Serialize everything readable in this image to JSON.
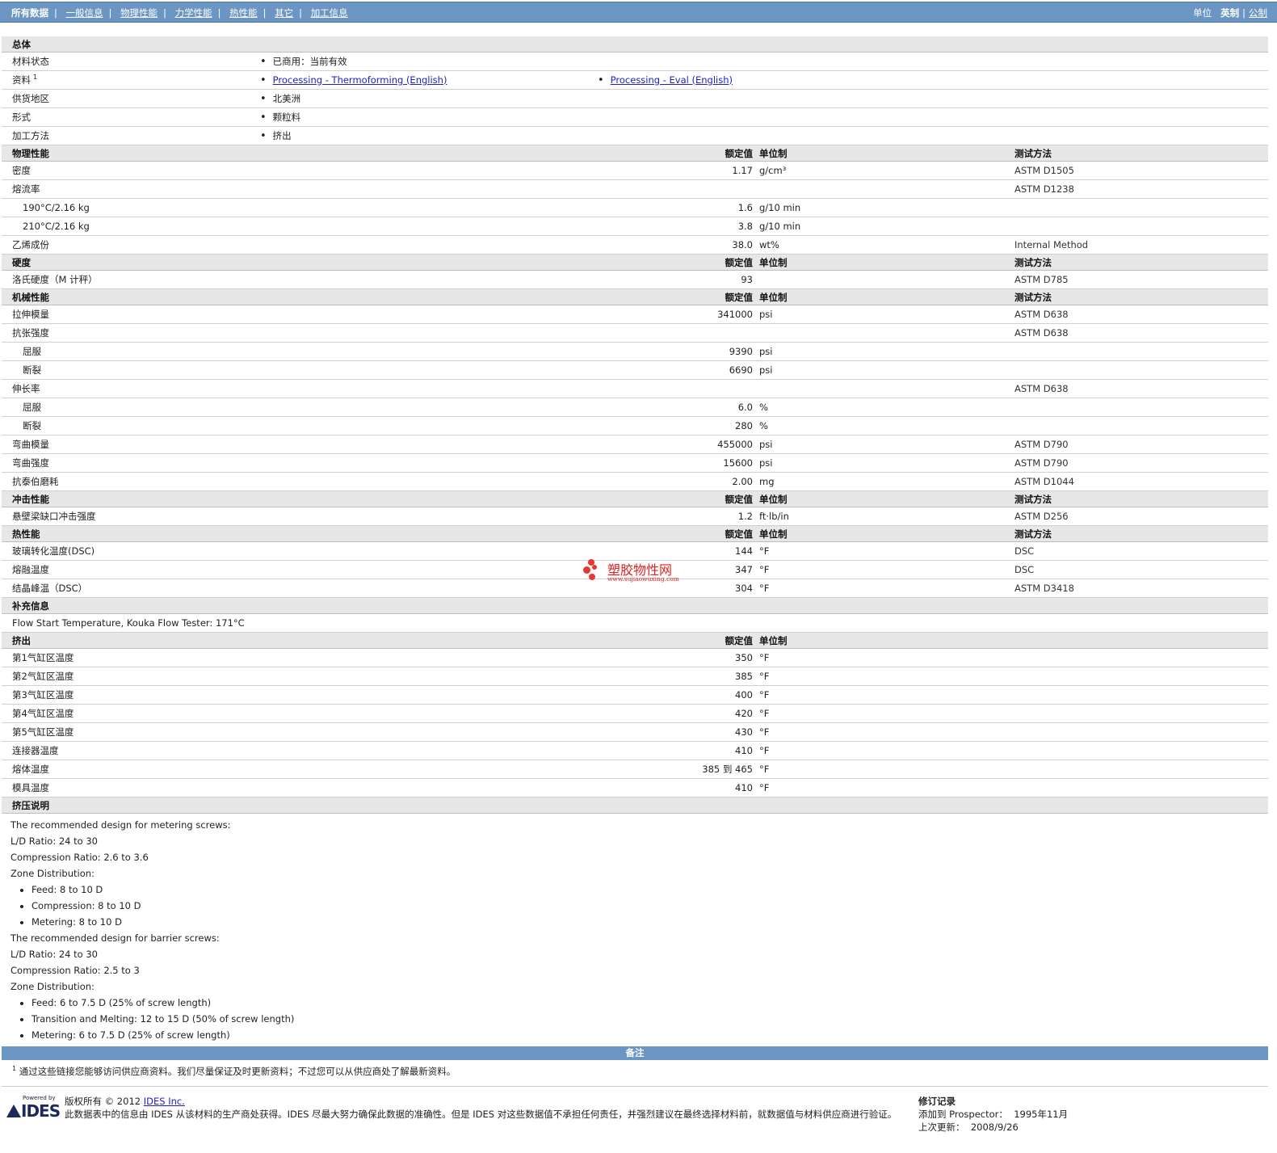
{
  "nav": {
    "items": [
      "所有数据",
      "一般信息",
      "物理性能",
      "力学性能",
      "热性能",
      "其它",
      "加工信息"
    ],
    "units_label": "单位",
    "units_current": "英制",
    "units_other": "公制"
  },
  "general": {
    "title": "总体",
    "rows": [
      {
        "label": "材料状态",
        "value": "已商用：当前有效"
      },
      {
        "label": "资料",
        "sup": "1",
        "link1": "Processing - Thermoforming (English)",
        "link2": "Processing - Eval (English)"
      },
      {
        "label": "供货地区",
        "value": "北美洲"
      },
      {
        "label": "形式",
        "value": "颗粒料"
      },
      {
        "label": "加工方法",
        "value": "挤出"
      }
    ]
  },
  "headers": {
    "nominal": "额定值",
    "unit": "单位制",
    "test": "测试方法"
  },
  "physical": {
    "title": "物理性能",
    "rows": [
      {
        "label": "密度",
        "value": "1.17",
        "unit": "g/cm³",
        "test": "ASTM D1505"
      },
      {
        "label": "熔流率",
        "value": "",
        "unit": "",
        "test": "ASTM D1238"
      },
      {
        "label": "190°C/2.16 kg",
        "value": "1.6",
        "unit": "g/10 min",
        "test": "",
        "sub": true
      },
      {
        "label": "210°C/2.16 kg",
        "value": "3.8",
        "unit": "g/10 min",
        "test": "",
        "sub": true
      },
      {
        "label": "乙烯成份",
        "value": "38.0",
        "unit": "wt%",
        "test": "Internal Method"
      }
    ]
  },
  "hardness": {
    "title": "硬度",
    "rows": [
      {
        "label": "洛氏硬度（M 计秤）",
        "value": "93",
        "unit": "",
        "test": "ASTM D785"
      }
    ]
  },
  "mechanical": {
    "title": "机械性能",
    "rows": [
      {
        "label": "拉伸模量",
        "value": "341000",
        "unit": "psi",
        "test": "ASTM D638"
      },
      {
        "label": "抗张强度",
        "value": "",
        "unit": "",
        "test": "ASTM D638"
      },
      {
        "label": "屈服",
        "value": "9390",
        "unit": "psi",
        "test": "",
        "sub": true
      },
      {
        "label": "断裂",
        "value": "6690",
        "unit": "psi",
        "test": "",
        "sub": true
      },
      {
        "label": "伸长率",
        "value": "",
        "unit": "",
        "test": "ASTM D638"
      },
      {
        "label": "屈服",
        "value": "6.0",
        "unit": "%",
        "test": "",
        "sub": true
      },
      {
        "label": "断裂",
        "value": "280",
        "unit": "%",
        "test": "",
        "sub": true
      },
      {
        "label": "弯曲模量",
        "value": "455000",
        "unit": "psi",
        "test": "ASTM D790"
      },
      {
        "label": "弯曲强度",
        "value": "15600",
        "unit": "psi",
        "test": "ASTM D790"
      },
      {
        "label": "抗泰伯磨耗",
        "value": "2.00",
        "unit": "mg",
        "test": "ASTM D1044"
      }
    ]
  },
  "impact": {
    "title": "冲击性能",
    "rows": [
      {
        "label": "悬壁梁缺口冲击强度",
        "value": "1.2",
        "unit": "ft·lb/in",
        "test": "ASTM D256"
      }
    ]
  },
  "thermal": {
    "title": "热性能",
    "rows": [
      {
        "label": "玻璃转化温度(DSC)",
        "value": "144",
        "unit": "°F",
        "test": "DSC"
      },
      {
        "label": "熔融温度",
        "value": "347",
        "unit": "°F",
        "test": "DSC"
      },
      {
        "label": "结晶峰温（DSC）",
        "value": "304",
        "unit": "°F",
        "test": "ASTM D3418"
      }
    ]
  },
  "supplement": {
    "title": "补充信息",
    "text": "Flow Start Temperature, Kouka Flow Tester: 171°C"
  },
  "extrusion": {
    "title": "挤出",
    "rows": [
      {
        "label": "第1气缸区温度",
        "value": "350",
        "unit": "°F"
      },
      {
        "label": "第2气缸区温度",
        "value": "385",
        "unit": "°F"
      },
      {
        "label": "第3气缸区温度",
        "value": "400",
        "unit": "°F"
      },
      {
        "label": "第4气缸区温度",
        "value": "420",
        "unit": "°F"
      },
      {
        "label": "第5气缸区温度",
        "value": "430",
        "unit": "°F"
      },
      {
        "label": "连接器温度",
        "value": "410",
        "unit": "°F"
      },
      {
        "label": "熔体温度",
        "value": "385 到  465",
        "unit": "°F"
      },
      {
        "label": "模具温度",
        "value": "410",
        "unit": "°F"
      }
    ]
  },
  "extrusion_notes": {
    "title": "挤压说明",
    "metering_intro": "The recommended design for metering screws:",
    "metering_ld": "L/D Ratio: 24 to 30",
    "metering_cr": "Compression Ratio: 2.6 to 3.6",
    "metering_zone": "Zone Distribution:",
    "metering_items": [
      "Feed: 8 to 10 D",
      "Compression: 8 to 10 D",
      "Metering: 8 to 10 D"
    ],
    "barrier_intro": "The recommended design for barrier screws:",
    "barrier_ld": "L/D Ratio: 24 to 30",
    "barrier_cr": "Compression Ratio: 2.5 to 3",
    "barrier_zone": "Zone Distribution:",
    "barrier_items": [
      "Feed: 6 to 7.5 D (25% of screw length)",
      "Transition and Melting: 12 to 15 D (50% of screw length)",
      "Metering: 6 to 7.5 D (25% of screw length)"
    ]
  },
  "remarks": {
    "title": "备注",
    "sup": "1",
    "text": "通过这些链接您能够访问供应商资料。我们尽量保证及时更新资料；不过您可以从供应商处了解最新资料。"
  },
  "watermark": {
    "name": "塑胶物性网",
    "url": "www.sujiaowuxing.com"
  },
  "footer": {
    "logo_powered": "Powered by",
    "logo_name": "IDES",
    "copyright": "版权所有  © 2012",
    "company_link": "IDES Inc.",
    "disclaimer": "此数据表中的信息由  IDES 从该材料的生产商处获得。IDES 尽最大努力确保此数据的准确性。但是  IDES 对这些数据值不承担任何责任，并强烈建议在最终选择材料前，就数据值与材料供应商进行验证。",
    "revision_title": "修订记录",
    "added_label": "添加到  Prospector：",
    "added_value": "1995年11月",
    "updated_label": "上次更新：",
    "updated_value": "2008/9/26"
  }
}
